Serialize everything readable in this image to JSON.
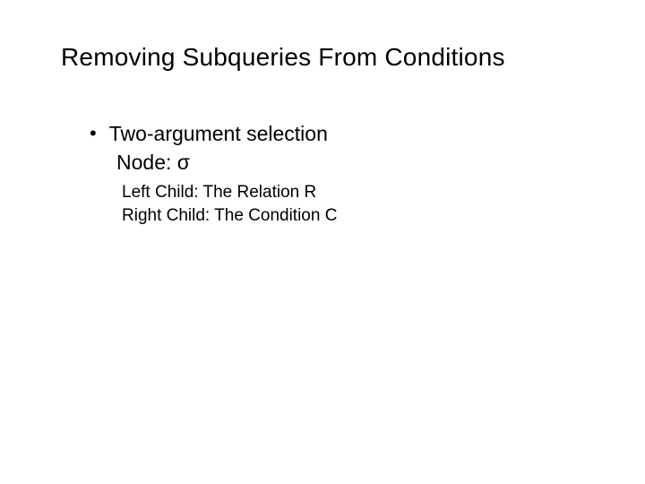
{
  "title": "Removing Subqueries From Conditions",
  "bullet": {
    "marker": "•",
    "text": "Two-argument selection"
  },
  "node_line": "Node: σ",
  "left_child": "Left Child: The Relation R",
  "right_child": "Right Child: The Condition C"
}
